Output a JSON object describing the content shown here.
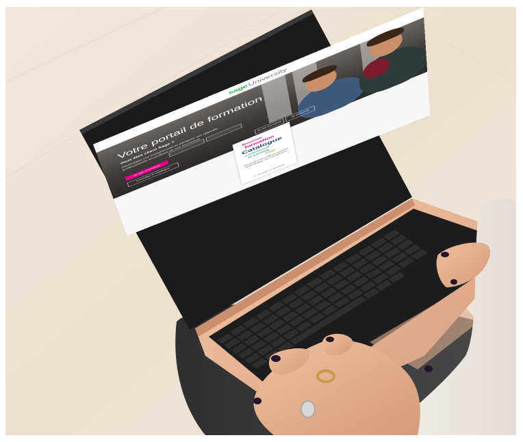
{
  "screen": {
    "logo": {
      "brand": "sage",
      "product": "University"
    },
    "hero": {
      "title": "Votre portail de formation",
      "subtitle": "Vous êtes client Sage ?",
      "description": "Développez vos compétences et atteignez vos objectifs professionnels en profitant de nos formations",
      "primary_button": "Je me connecte",
      "secondary_button": "Consulter le catalogue",
      "small_buttons": [
        "Je me connecte",
        "Je m'inscris"
      ]
    },
    "catalogue_card": {
      "words": [
        "Bienvenue",
        "formation",
        "Catalogue",
        "compétences",
        "eLearning",
        "Sage"
      ],
      "body": "Découvrez notre offre de formation et développez vos compétences.",
      "cta": "Je consulte le catalogue"
    }
  },
  "colors": {
    "sage_green": "#2fb45a",
    "cta_magenta": "#e2008a",
    "laptop_gold": "#e6b697",
    "keycap": "#262424",
    "background_floor": "#eee2d3",
    "skin": "#e2b18f",
    "nail_polish": "#25142a"
  }
}
